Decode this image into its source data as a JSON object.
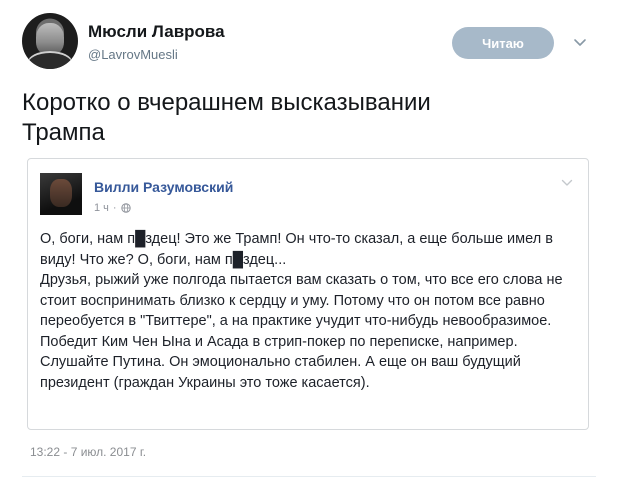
{
  "author": {
    "display_name": "Мюсли Лаврова",
    "handle": "@LavrovMuesli",
    "follow_label": "Читаю"
  },
  "tweet": {
    "text_line1": "Коротко о вчерашнем высказывании",
    "text_line2": "Трампа",
    "timestamp": "13:22 - 7 июл. 2017 г."
  },
  "embedded_post": {
    "author_name": "Вилли Разумовский",
    "meta_time": "1 ч",
    "meta_sep": "·",
    "paragraphs": [
      "О, боги, нам п█здец! Это же Трамп! Он что-то сказал, а еще больше имел в виду! Что же? О, боги, нам п█здец...",
      "Друзья, рыжий уже полгода пытается вам сказать о том, что все его слова не стоит воспринимать близко к сердцу и уму. Потому что он потом все равно переобуется в \"Твиттере\", а на практике учудит что-нибудь невообразимое. Победит Ким Чен Ына и Асада в стрип-покер по переписке, например.",
      "Слушайте Путина. Он эмоционально стабилен. А еще он ваш будущий президент (граждан Украины это тоже касается)."
    ]
  },
  "icons": {
    "caret": "chevron-down-icon",
    "globe": "globe-icon"
  },
  "colors": {
    "follow_button_bg": "#a7b9c9",
    "fb_name": "#365899",
    "secondary_text": "#657786"
  }
}
